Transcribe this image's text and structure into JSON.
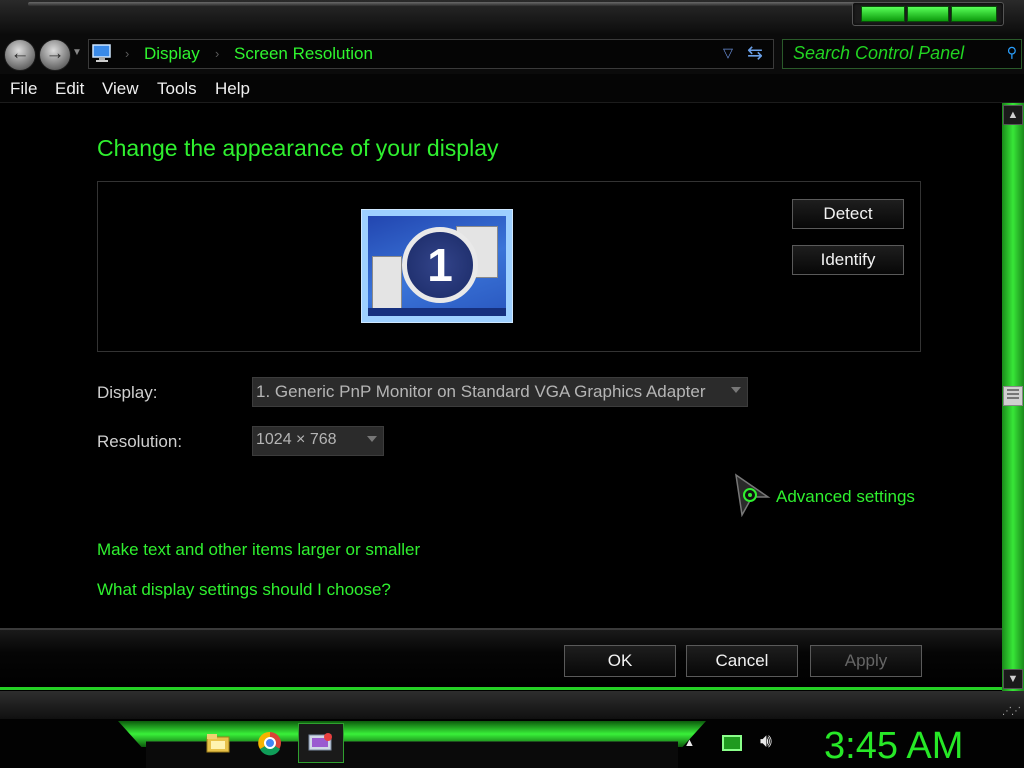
{
  "window": {
    "address": {
      "crumbs": [
        "Display",
        "Screen Resolution"
      ]
    },
    "search": {
      "placeholder": "Search Control Panel"
    },
    "menu": [
      "File",
      "Edit",
      "View",
      "Tools",
      "Help"
    ]
  },
  "main": {
    "heading": "Change the appearance of your display",
    "monitor_number": "1",
    "detect_label": "Detect",
    "identify_label": "Identify",
    "display_label": "Display:",
    "display_value": "1. Generic PnP Monitor on Standard VGA Graphics Adapter",
    "resolution_label": "Resolution:",
    "resolution_value": "1024 × 768",
    "advanced_link": "Advanced settings",
    "links": [
      "Make text and other items larger or smaller",
      "What display settings should I choose?"
    ]
  },
  "footer": {
    "ok_label": "OK",
    "cancel_label": "Cancel",
    "apply_label": "Apply"
  },
  "taskbar": {
    "clock": "3:45 AM",
    "icons": [
      "file-explorer-icon",
      "chrome-icon",
      "display-settings-icon"
    ]
  },
  "colors": {
    "accent_green": "#2ff02f",
    "background": "#000000"
  }
}
